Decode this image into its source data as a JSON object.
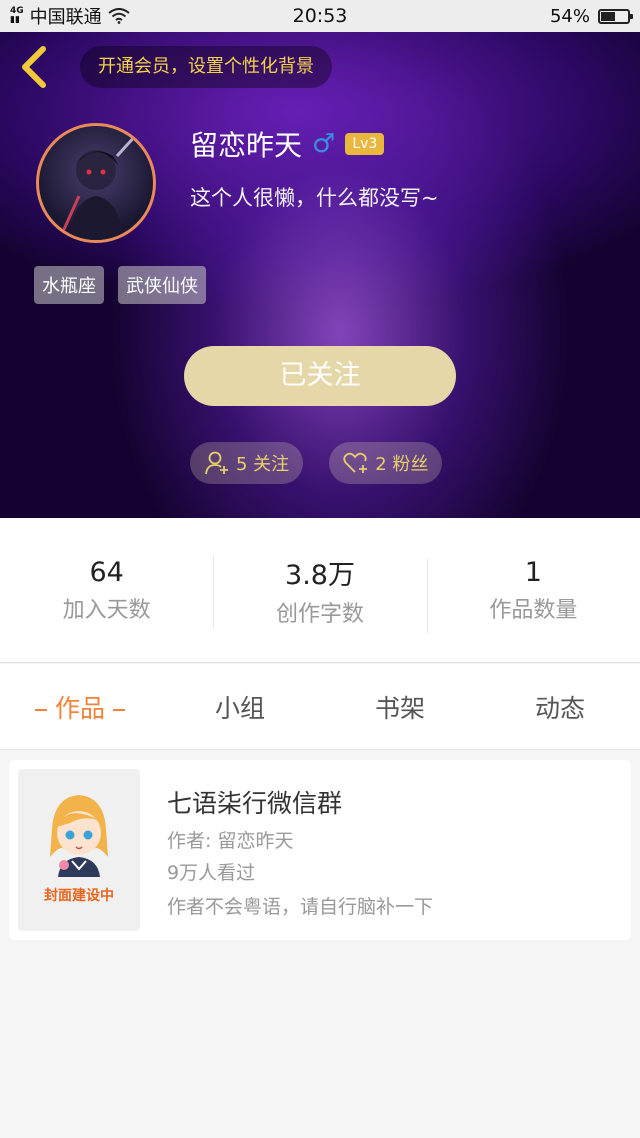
{
  "status_bar": {
    "network_type": "4G",
    "carrier": "中国联通",
    "time": "20:53",
    "battery_percent": "54%",
    "battery_level": 0.54
  },
  "header": {
    "vip_promo": "开通会员，设置个性化背景",
    "username": "留恋昨天",
    "gender_symbol": "♂",
    "level_badge": "Lv3",
    "bio": "这个人很懒，什么都没写~",
    "tags": [
      "水瓶座",
      "武侠仙侠"
    ],
    "follow_button_label": "已关注",
    "following_label": "5 关注",
    "fans_label": "2 粉丝"
  },
  "stats": [
    {
      "value": "64",
      "label": "加入天数"
    },
    {
      "value": "3.8万",
      "label": "创作字数"
    },
    {
      "value": "1",
      "label": "作品数量"
    }
  ],
  "tabs": [
    {
      "label": "作品",
      "active": true
    },
    {
      "label": "小组",
      "active": false
    },
    {
      "label": "书架",
      "active": false
    },
    {
      "label": "动态",
      "active": false
    }
  ],
  "works": [
    {
      "cover_text": "封面建设中",
      "title": "七语柒行微信群",
      "author_line": "作者: 留恋昨天",
      "views_line": "9万人看过",
      "description": "作者不会粤语，请自行脑补一下"
    }
  ],
  "colors": {
    "accent_orange": "#f0833a",
    "gold_text": "#f4d24a",
    "follow_button": "#e6d7a8",
    "level_badge": "#e9b73e",
    "gender_blue": "#3b8fe0"
  }
}
